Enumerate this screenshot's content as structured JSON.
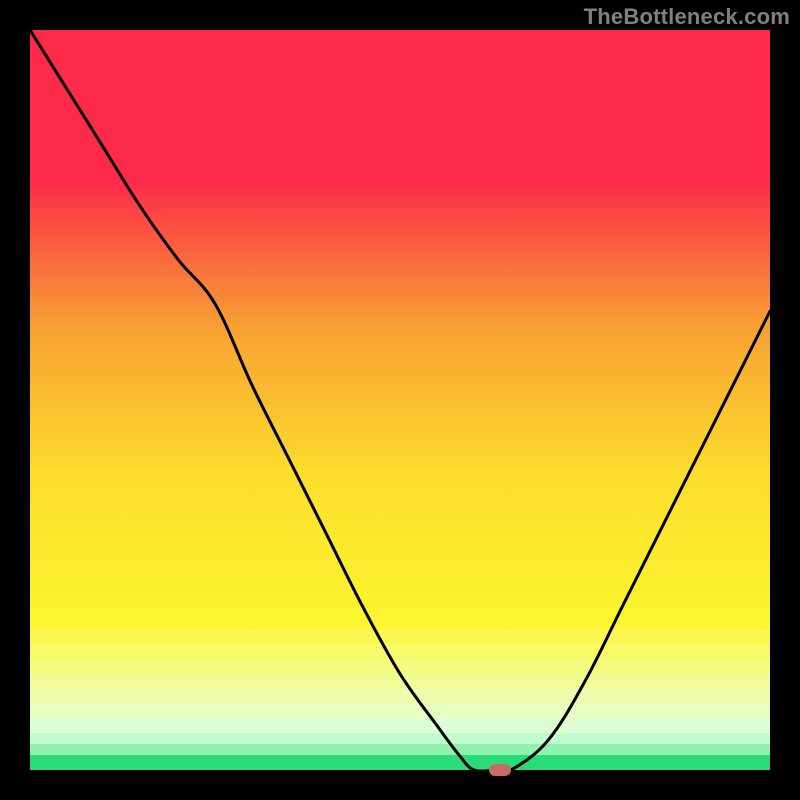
{
  "watermark": "TheBottleneck.com",
  "colors": {
    "frame": "#000000",
    "curve": "#000000",
    "marker": "#c86a6a",
    "watermark_text": "#808080"
  },
  "chart_data": {
    "type": "line",
    "title": "",
    "xlabel": "",
    "ylabel": "",
    "xlim": [
      0,
      100
    ],
    "ylim": [
      0,
      100
    ],
    "x": [
      0,
      5,
      10,
      15,
      20,
      25,
      30,
      35,
      40,
      45,
      50,
      55,
      58,
      60,
      63,
      65,
      70,
      75,
      80,
      85,
      90,
      95,
      100
    ],
    "values": [
      100,
      92,
      84,
      76,
      69,
      63,
      52,
      42,
      32,
      22,
      13,
      6,
      2,
      0,
      0,
      0,
      4,
      12,
      22,
      32,
      42,
      52,
      62
    ],
    "marker": {
      "x": 63.5,
      "y": 0
    },
    "background_bands": [
      {
        "from_y": 100,
        "to_y": 19,
        "type": "gradient",
        "colors": [
          "#fd2a49",
          "#fd2a49",
          "#f7a233",
          "#fcdf2c",
          "#fbf62f"
        ]
      },
      {
        "from_y": 19,
        "to_y": 17,
        "color": "#fbf853"
      },
      {
        "from_y": 17,
        "to_y": 15,
        "color": "#f8fa69"
      },
      {
        "from_y": 15,
        "to_y": 13,
        "color": "#f5fb7f"
      },
      {
        "from_y": 13,
        "to_y": 11,
        "color": "#f1fc95"
      },
      {
        "from_y": 11,
        "to_y": 9,
        "color": "#edfdab"
      },
      {
        "from_y": 9,
        "to_y": 7,
        "color": "#e7fec1"
      },
      {
        "from_y": 7,
        "to_y": 5,
        "color": "#dcfed4"
      },
      {
        "from_y": 5,
        "to_y": 3.5,
        "color": "#c3fcd0"
      },
      {
        "from_y": 3.5,
        "to_y": 2,
        "color": "#8ef2ae"
      },
      {
        "from_y": 2,
        "to_y": 0,
        "color": "#2bdb78"
      }
    ]
  }
}
